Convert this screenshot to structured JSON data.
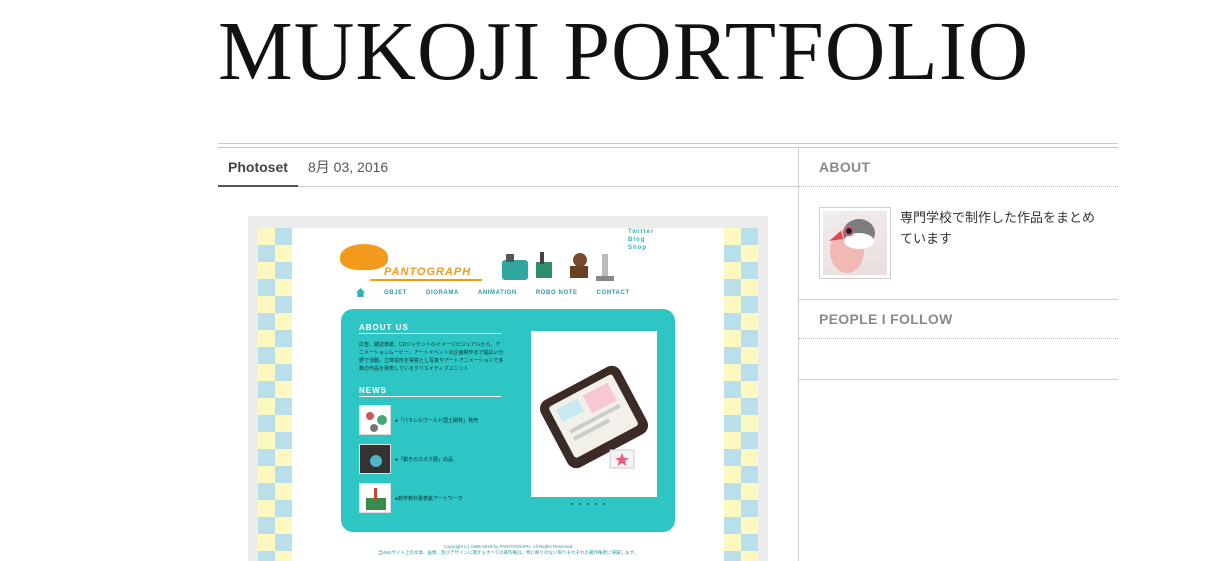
{
  "site": {
    "title": "MUKOJI PORTFOLIO"
  },
  "post": {
    "type": "Photoset",
    "date": "8月 03, 2016"
  },
  "sidebar": {
    "about_heading": "ABOUT",
    "about_text": "専門学校で制作した作品をまとめています",
    "follow_heading": "PEOPLE I FOLLOW"
  },
  "photo": {
    "logo": "PANTOGRAPH",
    "links": [
      "Twitter",
      "Blog",
      "Shop"
    ],
    "nav": [
      "OBJET",
      "DIORAMA",
      "ANIMATION",
      "ROBO NOTE",
      "CONTACT"
    ],
    "about_heading": "ABOUT US",
    "about_body": "広告、雑誌表紙、CDジャケットのイメージビジュアルから、アニメーションムービー、アートイベントの企画制作まで幅広い分野で活動。立体造形を得意とし写真やアートアニメーションで多数の作品を発表しているクリエイティブユニット",
    "news_heading": "NEWS",
    "news": [
      "●「パラレルワールド国土開発」発売",
      "●「動きのカガク展」出品",
      "●数学教科書表紙アートワーク"
    ],
    "copyright": "Copyright (c) 1988-2016 by PANTOGRAPH. All Rights Reserved",
    "copyright_note": "当Webサイト上の文章、画像、及びデザインに関するすべての著作権は、特に断りのない限りそれぞれの著作権者に帰属します。"
  }
}
